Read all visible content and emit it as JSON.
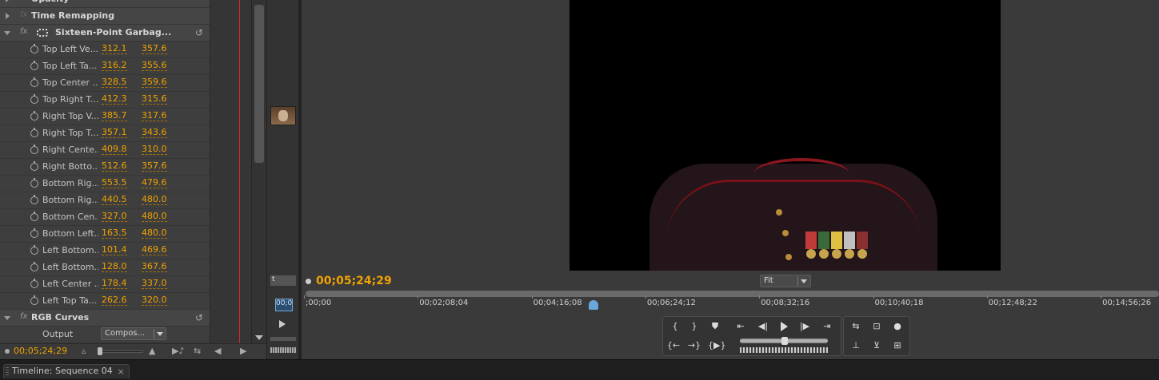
{
  "effect_controls": {
    "rows": [
      {
        "type": "header-partial",
        "label": "Opacity",
        "expanded": false
      },
      {
        "type": "header",
        "label": "Time Remapping",
        "expanded": false,
        "fx_enabled": false
      },
      {
        "type": "header",
        "label": "Sixteen-Point Garbag...",
        "expanded": true,
        "fx_enabled": true,
        "mask_icon": true,
        "reset": true
      },
      {
        "type": "param",
        "label": "Top Left Ve...",
        "x": "312.1",
        "y": "357.6"
      },
      {
        "type": "param",
        "label": "Top Left Ta...",
        "x": "316.2",
        "y": "355.6"
      },
      {
        "type": "param",
        "label": "Top Center ...",
        "x": "328.5",
        "y": "359.6"
      },
      {
        "type": "param",
        "label": "Top Right T...",
        "x": "412.3",
        "y": "315.6"
      },
      {
        "type": "param",
        "label": "Right Top V...",
        "x": "385.7",
        "y": "317.6"
      },
      {
        "type": "param",
        "label": "Right Top T...",
        "x": "357.1",
        "y": "343.6"
      },
      {
        "type": "param",
        "label": "Right Cente...",
        "x": "409.8",
        "y": "310.0"
      },
      {
        "type": "param",
        "label": "Right Botto...",
        "x": "512.6",
        "y": "357.6"
      },
      {
        "type": "param",
        "label": "Bottom Rig...",
        "x": "553.5",
        "y": "479.6"
      },
      {
        "type": "param",
        "label": "Bottom Rig...",
        "x": "440.5",
        "y": "480.0"
      },
      {
        "type": "param",
        "label": "Bottom Cen...",
        "x": "327.0",
        "y": "480.0"
      },
      {
        "type": "param",
        "label": "Bottom Left...",
        "x": "163.5",
        "y": "480.0"
      },
      {
        "type": "param",
        "label": "Left Bottom...",
        "x": "101.4",
        "y": "469.6"
      },
      {
        "type": "param",
        "label": "Left Bottom...",
        "x": "128.0",
        "y": "367.6"
      },
      {
        "type": "param",
        "label": "Left Center ...",
        "x": "178.4",
        "y": "337.0"
      },
      {
        "type": "param",
        "label": "Left Top Ta...",
        "x": "262.6",
        "y": "320.0"
      },
      {
        "type": "header",
        "label": "RGB Curves",
        "expanded": true,
        "fx_enabled": true,
        "reset": true
      },
      {
        "type": "output",
        "label": "Output",
        "value": "Compos..."
      }
    ],
    "timecode": "00;05;24;29"
  },
  "mid_strip": {
    "tab_fragment": "t",
    "marker_label": "00;0"
  },
  "program_monitor": {
    "timecode": "00;05;24;29",
    "zoom": "Fit",
    "ruler_ticks": [
      ";00;00",
      "00;02;08;04",
      "00;04;16;08",
      "00;06;24;12",
      "00;08;32;16",
      "00;10;40;18",
      "00;12;48;22",
      "00;14;56;26"
    ],
    "playhead_fraction": 0.337
  },
  "bottom_tab": {
    "label": "Timeline: Sequence 04",
    "close": "×"
  },
  "colors": {
    "timecode": "#f0a300",
    "playhead": "#d02a2a",
    "marker": "#6aa7dd"
  }
}
